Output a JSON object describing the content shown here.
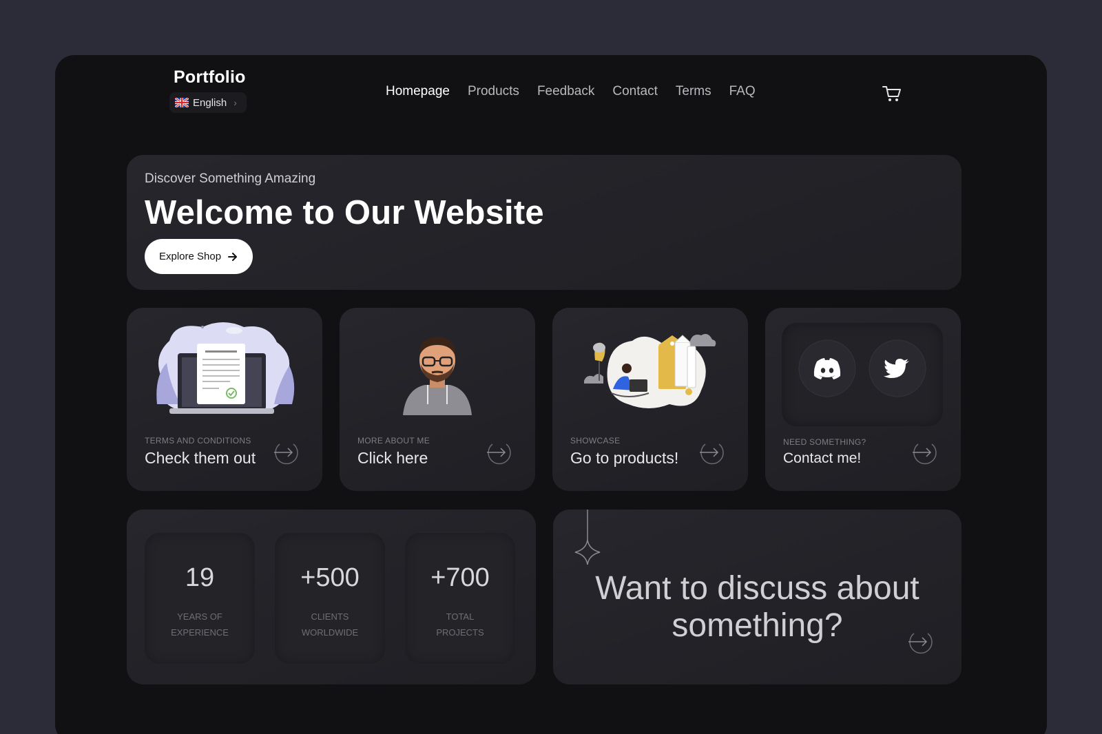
{
  "header": {
    "brand": "Portfolio",
    "language": "English",
    "nav": [
      "Homepage",
      "Products",
      "Feedback",
      "Contact",
      "Terms",
      "FAQ"
    ],
    "active_nav": "Homepage",
    "cart_icon": "shopping-cart-icon"
  },
  "hero": {
    "kicker": "Discover Something Amazing",
    "title": "Welcome to Our Website",
    "button": "Explore Shop"
  },
  "tiles": [
    {
      "kicker": "TERMS AND CONDITIONS",
      "label": "Check them out",
      "illustration": "terms-document-illustration"
    },
    {
      "kicker": "MORE ABOUT ME",
      "label": "Click here",
      "illustration": "avatar-illustration"
    },
    {
      "kicker": "SHOWCASE",
      "label": "Go to products!",
      "illustration": "shopping-illustration"
    },
    {
      "kicker": "NEED SOMETHING?",
      "label": "Contact me!",
      "icons": [
        "discord-icon",
        "twitter-icon"
      ]
    }
  ],
  "stats": [
    {
      "value": "19",
      "line1": "YEARS OF",
      "line2": "EXPERIENCE"
    },
    {
      "value": "+500",
      "line1": "CLIENTS",
      "line2": "WORLDWIDE"
    },
    {
      "value": "+700",
      "line1": "TOTAL",
      "line2": "PROJECTS"
    }
  ],
  "discuss": {
    "line1": "Want to discuss about",
    "line2": "something?"
  },
  "colors": {
    "page_bg": "#2b2c37",
    "window_bg": "#111114",
    "card_bg": "#232328",
    "accent_purple": "#8f8fd6",
    "accent_yellow": "#e3b94a",
    "accent_blue": "#2f63e0"
  }
}
